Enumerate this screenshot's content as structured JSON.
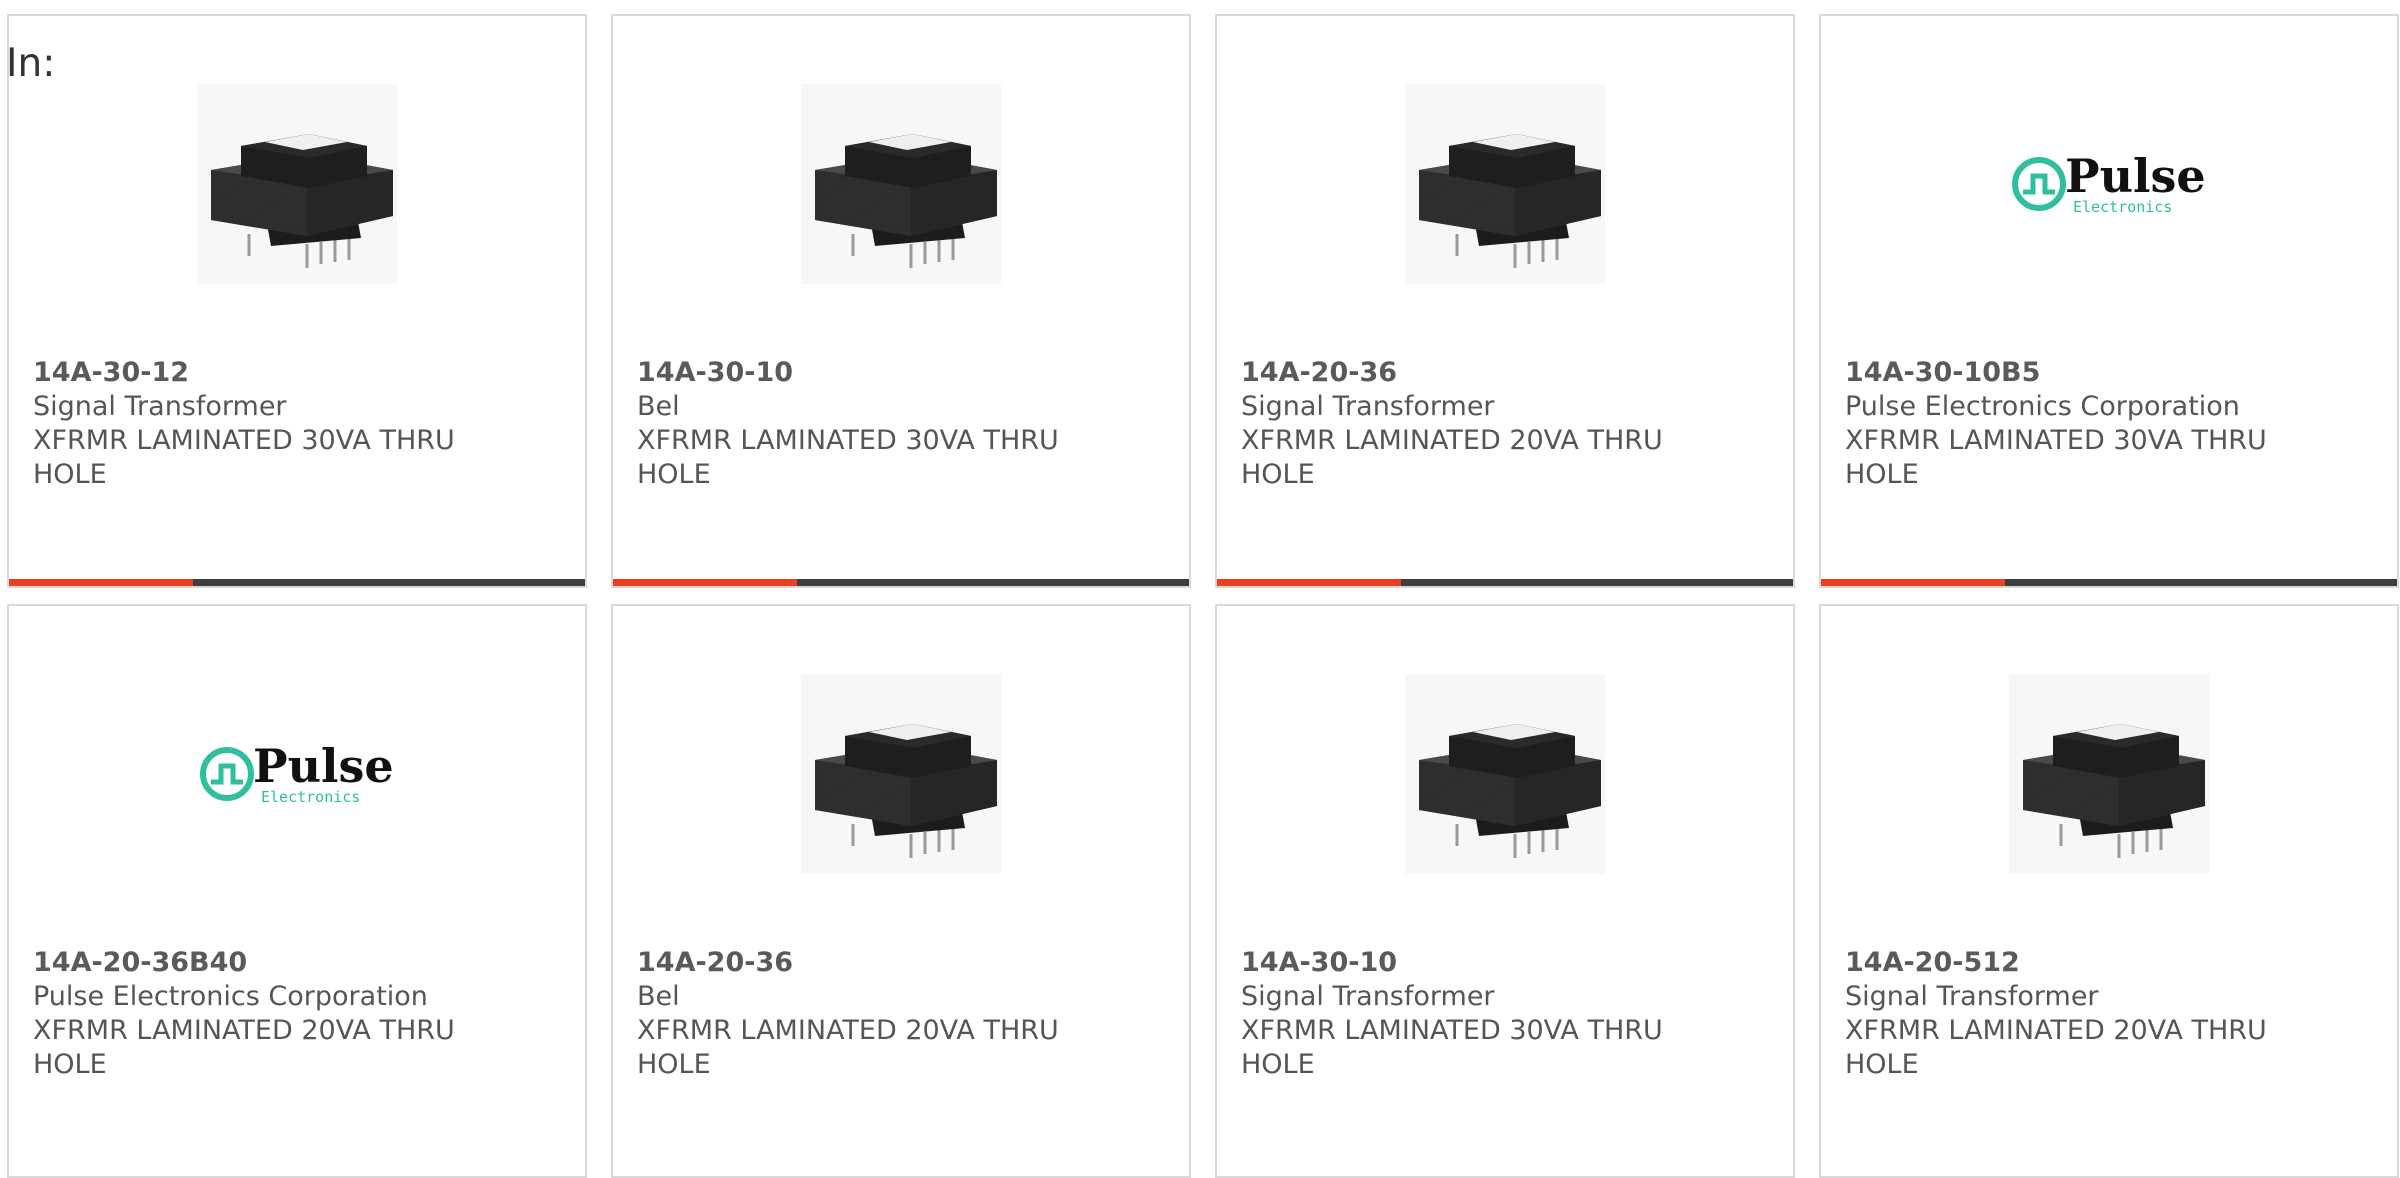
{
  "filter_label": "In:",
  "colors": {
    "accent": "#e8411b",
    "bar": "#3d3d3d",
    "logo": "#2fbf9f"
  },
  "products": [
    {
      "part": "14A-30-12",
      "maker": "Signal Transformer",
      "desc": "XFRMR LAMINATED 30VA THRU HOLE",
      "image": "transformer-photo",
      "progress": 0.32
    },
    {
      "part": "14A-30-10",
      "maker": "Bel",
      "desc": "XFRMR LAMINATED 30VA THRU HOLE",
      "image": "transformer-photo",
      "progress": 0.32
    },
    {
      "part": "14A-20-36",
      "maker": "Signal Transformer",
      "desc": "XFRMR LAMINATED 20VA THRU HOLE",
      "image": "transformer-photo",
      "progress": 0.32
    },
    {
      "part": "14A-30-10B5",
      "maker": "Pulse Electronics Corporation",
      "desc": "XFRMR LAMINATED 30VA THRU HOLE",
      "image": "pulse-logo",
      "logo_text": "Pulse",
      "logo_sub": "Electronics",
      "progress": 0.32
    },
    {
      "part": "14A-20-36B40",
      "maker": "Pulse Electronics Corporation",
      "desc": "XFRMR LAMINATED 20VA THRU HOLE",
      "image": "pulse-logo",
      "logo_text": "Pulse",
      "logo_sub": "Electronics"
    },
    {
      "part": "14A-20-36",
      "maker": "Bel",
      "desc": "XFRMR LAMINATED 20VA THRU HOLE",
      "image": "transformer-photo"
    },
    {
      "part": "14A-30-10",
      "maker": "Signal Transformer",
      "desc": "XFRMR LAMINATED 30VA THRU HOLE",
      "image": "transformer-photo"
    },
    {
      "part": "14A-20-512",
      "maker": "Signal Transformer",
      "desc": "XFRMR LAMINATED 20VA THRU HOLE",
      "image": "transformer-photo"
    }
  ]
}
